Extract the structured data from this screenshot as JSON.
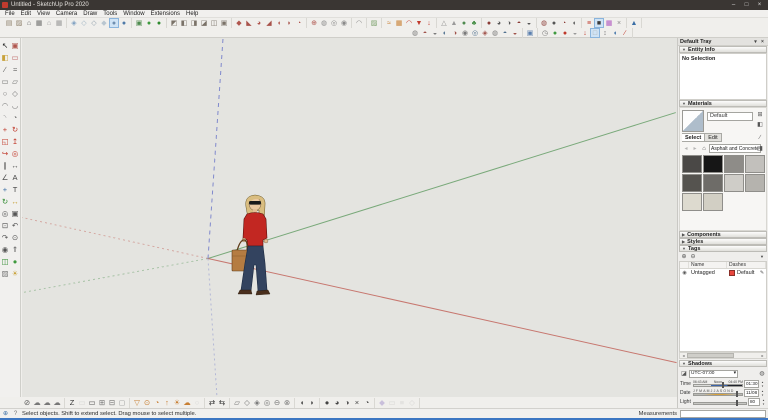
{
  "window": {
    "title": "Untitled - SketchUp Pro 2020",
    "controls": {
      "minimize": "–",
      "maximize": "□",
      "close": "×"
    }
  },
  "menu": {
    "items": [
      "File",
      "Edit",
      "View",
      "Camera",
      "Draw",
      "Tools",
      "Window",
      "Extensions",
      "Help"
    ]
  },
  "toolbar_top": {
    "g1": [
      {
        "n": "new-icon",
        "g": "▤",
        "c": "#8d7f6a"
      },
      {
        "n": "open-icon",
        "g": "▨",
        "c": "#8d7f6a"
      },
      {
        "n": "save-icon",
        "g": "⌂",
        "c": "#5f5f5f"
      },
      {
        "n": "print-icon",
        "g": "▦",
        "c": "#6f6f6f"
      },
      {
        "n": "new-template-icon",
        "g": "⌂",
        "c": "#9a9a9a"
      },
      {
        "n": "print-preview-icon",
        "g": "▦",
        "c": "#9a9a9a"
      }
    ],
    "g2": [
      {
        "n": "xray-icon",
        "g": "◈",
        "c": "#7d9fc0"
      },
      {
        "n": "back-edges-icon",
        "g": "◇",
        "c": "#9ab0c0"
      },
      {
        "n": "wireframe-icon",
        "g": "◇",
        "c": "#8a9aa8"
      },
      {
        "n": "hidden-line-icon",
        "g": "◆",
        "c": "#b9c6d0"
      },
      {
        "n": "shaded-icon",
        "g": "●",
        "c": "#6f8fb0",
        "active": true
      },
      {
        "n": "shaded-textures-icon",
        "g": "●",
        "c": "#4f7aa8"
      }
    ],
    "g3": [
      {
        "n": "in-model-icon",
        "g": "▣",
        "c": "#4d8a4d"
      },
      {
        "n": "components-sphere-icon",
        "g": "●",
        "c": "#3f9a3f"
      },
      {
        "n": "warehouse-sphere-icon",
        "g": "●",
        "c": "#2f8a2f"
      }
    ],
    "g4": [
      {
        "n": "iso-view-icon",
        "g": "◩",
        "c": "#7a7268"
      },
      {
        "n": "top-view-icon",
        "g": "◧",
        "c": "#7a7268"
      },
      {
        "n": "front-view-icon",
        "g": "◨",
        "c": "#7a7268"
      },
      {
        "n": "right-view-icon",
        "g": "◪",
        "c": "#7a7268"
      },
      {
        "n": "back-view-icon",
        "g": "◫",
        "c": "#7a7268"
      },
      {
        "n": "left-view-icon",
        "g": "▣",
        "c": "#7a7268"
      }
    ],
    "g5": [
      {
        "n": "outer-shell-icon",
        "g": "◆",
        "c": "#b0564e"
      },
      {
        "n": "intersect-icon",
        "g": "◣",
        "c": "#a8524a"
      },
      {
        "n": "union-icon",
        "g": "◕",
        "c": "#b0564e"
      },
      {
        "n": "subtract-icon",
        "g": "◢",
        "c": "#a8524a"
      },
      {
        "n": "trim-icon",
        "g": "◖",
        "c": "#b0564e"
      },
      {
        "n": "split-icon",
        "g": "◗",
        "c": "#a8524a"
      },
      {
        "n": "soften-icon",
        "g": "◔",
        "c": "#b0564e"
      }
    ],
    "g6": [
      {
        "n": "section-plane-icon",
        "g": "⊕",
        "c": "#b0564e"
      },
      {
        "n": "display-section-planes-icon",
        "g": "◍",
        "c": "#8a8a8a"
      },
      {
        "n": "display-section-cuts-icon",
        "g": "◎",
        "c": "#8a8a8a"
      },
      {
        "n": "section-fill-icon",
        "g": "◉",
        "c": "#8a8a8a"
      }
    ],
    "g7": [
      {
        "n": "bezier-icon",
        "g": "◠",
        "c": "#888888"
      }
    ],
    "g8": [
      {
        "n": "photo-match-icon",
        "g": "▨",
        "c": "#7aa06a"
      }
    ],
    "g9": [
      {
        "n": "from-contours-icon",
        "g": "≈",
        "c": "#c87f33"
      },
      {
        "n": "from-scratch-icon",
        "g": "▦",
        "c": "#c87f33"
      },
      {
        "n": "smoove-icon",
        "g": "◠",
        "c": "#c0392b"
      },
      {
        "n": "stamp-icon",
        "g": "▼",
        "c": "#c0392b"
      },
      {
        "n": "drape-icon",
        "g": "↓",
        "c": "#c0392b"
      }
    ],
    "g10": [
      {
        "n": "add-detail-icon",
        "g": "△",
        "c": "#8a8a8a"
      },
      {
        "n": "flip-edge-icon",
        "g": "▲",
        "c": "#9a9a9a"
      },
      {
        "n": "earth-icon",
        "g": "●",
        "c": "#4f8a4f"
      },
      {
        "n": "foliage-icon",
        "g": "♣",
        "c": "#3f8a3f"
      }
    ],
    "g11": [
      {
        "n": "interact-icon",
        "g": "●",
        "c": "#8a3b35"
      },
      {
        "n": "component-options-icon",
        "g": "◕",
        "c": "#555555"
      },
      {
        "n": "component-attributes-icon",
        "g": "◑",
        "c": "#555555"
      },
      {
        "n": "fog-icon",
        "g": "◓",
        "c": "#8a3b35"
      },
      {
        "n": "soften-edges-icon",
        "g": "◒",
        "c": "#555555"
      }
    ],
    "g12": [
      {
        "n": "warehouse-icon",
        "g": "◍",
        "c": "#8a3b35"
      },
      {
        "n": "share-model-icon",
        "g": "●",
        "c": "#555555"
      },
      {
        "n": "share-component-icon",
        "g": "◔",
        "c": "#8a3b35"
      },
      {
        "n": "extension-store-icon",
        "g": "◖",
        "c": "#555555"
      }
    ],
    "g13": [
      {
        "n": "tags-toolbar-icon",
        "g": "≡",
        "c": "#c0392b"
      },
      {
        "n": "screen-icon",
        "g": "■",
        "c": "#3a3a3a",
        "active": true
      },
      {
        "n": "color-gradient-icon",
        "g": "▦",
        "c": "#b05ac0"
      },
      {
        "n": "cut-icon",
        "g": "×",
        "c": "#888888"
      }
    ],
    "g14": [
      {
        "n": "layout-icon",
        "g": "▲",
        "c": "#3a6ea5"
      }
    ]
  },
  "toolbar_second": {
    "s1": [
      {
        "n": "create-camera-icon",
        "g": "◍",
        "c": "#7a7a7a"
      },
      {
        "n": "look-through-camera-icon",
        "g": "◓",
        "c": "#a0524a"
      },
      {
        "n": "lock-camera-icon",
        "g": "◒",
        "c": "#7a7a7a"
      },
      {
        "n": "camera-dolly-icon",
        "g": "◐",
        "c": "#51718f"
      },
      {
        "n": "camera-pan-icon",
        "g": "◑",
        "c": "#a0524a"
      },
      {
        "n": "camera-orbit-icon",
        "g": "◉",
        "c": "#7a7a7a"
      },
      {
        "n": "camera-zoom-icon",
        "g": "◎",
        "c": "#51718f"
      },
      {
        "n": "camera-roll-icon",
        "g": "◈",
        "c": "#a0524a"
      },
      {
        "n": "camera-truck-icon",
        "g": "◍",
        "c": "#7a7a7a"
      },
      {
        "n": "camera-pedestal-icon",
        "g": "◓",
        "c": "#51718f"
      },
      {
        "n": "camera-frustum-icon",
        "g": "◒",
        "c": "#a0524a"
      }
    ],
    "s2": [
      {
        "n": "save-scene-icon",
        "g": "▣",
        "c": "#5b7fae"
      }
    ],
    "s3": [
      {
        "n": "time-icon",
        "g": "◷",
        "c": "#777777"
      },
      {
        "n": "add-location-icon",
        "g": "●",
        "c": "#3f9a3f"
      },
      {
        "n": "remove-location-icon",
        "g": "●",
        "c": "#c0392b"
      },
      {
        "n": "show-terrain-icon",
        "g": "◒",
        "c": "#999999"
      },
      {
        "n": "import-terrain-icon",
        "g": "↓",
        "c": "#c0392b"
      },
      {
        "n": "toggle-terrain-icon",
        "g": "□",
        "c": "#aaaaaa",
        "active": true
      },
      {
        "n": "elevation-icon",
        "g": "↕",
        "c": "#777777"
      },
      {
        "n": "speech-icon",
        "g": "◖",
        "c": "#3a6ea5"
      },
      {
        "n": "redline-icon",
        "g": "∕",
        "c": "#c0392b"
      }
    ]
  },
  "left_palette": {
    "tools": [
      {
        "n": "select-icon",
        "g": "↖",
        "c": "#222222"
      },
      {
        "n": "make-component-icon",
        "g": "▣",
        "c": "#b0564e"
      },
      {
        "n": "paint-bucket-icon",
        "g": "◧",
        "c": "#c8a23a"
      },
      {
        "n": "eraser-icon",
        "g": "▭",
        "c": "#c06a6a"
      },
      {
        "n": "line-icon",
        "g": "∕",
        "c": "#555555"
      },
      {
        "n": "freehand-icon",
        "g": "≈",
        "c": "#555555"
      },
      {
        "n": "rectangle-icon",
        "g": "▭",
        "c": "#777777"
      },
      {
        "n": "rotated-rectangle-icon",
        "g": "▱",
        "c": "#777777"
      },
      {
        "n": "circle-icon",
        "g": "○",
        "c": "#777777"
      },
      {
        "n": "polygon-icon",
        "g": "◇",
        "c": "#777777"
      },
      {
        "n": "arc-icon",
        "g": "◠",
        "c": "#777777"
      },
      {
        "n": "two-point-arc-icon",
        "g": "◡",
        "c": "#777777"
      },
      {
        "n": "three-point-arc-icon",
        "g": "◝",
        "c": "#999999"
      },
      {
        "n": "pie-icon",
        "g": "◔",
        "c": "#777777"
      },
      {
        "n": "move-icon",
        "g": "+",
        "c": "#c0392b"
      },
      {
        "n": "rotate-icon",
        "g": "↻",
        "c": "#c0392b"
      },
      {
        "n": "scale-icon",
        "g": "◱",
        "c": "#c0392b"
      },
      {
        "n": "push-pull-icon",
        "g": "↥",
        "c": "#c0392b"
      },
      {
        "n": "follow-me-icon",
        "g": "↪",
        "c": "#c0392b"
      },
      {
        "n": "offset-icon",
        "g": "◎",
        "c": "#c0392b"
      },
      {
        "n": "tape-measure-icon",
        "g": "∥",
        "c": "#555555"
      },
      {
        "n": "dimensions-icon",
        "g": "↔",
        "c": "#555555"
      },
      {
        "n": "protractor-icon",
        "g": "∠",
        "c": "#555555"
      },
      {
        "n": "text-icon",
        "g": "A",
        "c": "#444444"
      },
      {
        "n": "axes-icon",
        "g": "+",
        "c": "#3a6ea5"
      },
      {
        "n": "3d-text-icon",
        "g": "T",
        "c": "#444444"
      },
      {
        "n": "orbit-icon",
        "g": "↻",
        "c": "#2f8a2f"
      },
      {
        "n": "pan-icon",
        "g": "↔",
        "c": "#c8a23a"
      },
      {
        "n": "zoom-icon",
        "g": "◎",
        "c": "#555555"
      },
      {
        "n": "zoom-window-icon",
        "g": "▣",
        "c": "#555555"
      },
      {
        "n": "zoom-extents-icon",
        "g": "⊡",
        "c": "#555555"
      },
      {
        "n": "previous-icon",
        "g": "↶",
        "c": "#555555"
      },
      {
        "n": "next-icon",
        "g": "↷",
        "c": "#555555"
      },
      {
        "n": "position-camera-icon",
        "g": "⊙",
        "c": "#555555"
      },
      {
        "n": "look-around-icon",
        "g": "◉",
        "c": "#555555"
      },
      {
        "n": "walk-icon",
        "g": "⇑",
        "c": "#555555"
      },
      {
        "n": "section-plane-icon",
        "g": "◫",
        "c": "#2f8a2f"
      },
      {
        "n": "add-location-icon",
        "g": "●",
        "c": "#3f9a3f"
      },
      {
        "n": "match-photo-icon",
        "g": "▨",
        "c": "#777777"
      },
      {
        "n": "shadows-icon",
        "g": "☀",
        "c": "#c8a23a"
      }
    ]
  },
  "viewport": {
    "background": "#e4e4e0",
    "axes": {
      "red": "#c7776f",
      "green": "#79a97a",
      "blue": "#8089cc"
    },
    "figure": {
      "hair": "#d9bd80",
      "skin": "#ecc9a0",
      "sweater": "#c22722",
      "jeans": "#33435f",
      "bag": "#b57c42"
    }
  },
  "tray": {
    "title": "Default Tray",
    "pin_icon": "▾",
    "close_icon": "×",
    "entity_info": {
      "arrow": "▼",
      "title": "Entity Info",
      "message": "No Selection"
    },
    "materials": {
      "arrow": "▼",
      "title": "Materials",
      "name_value": "Default",
      "create_icon": "⊞",
      "default_paint_icon": "◧",
      "sample_icon": "∕",
      "tabs": [
        {
          "n": "tab-select",
          "label": "Select",
          "active": true
        },
        {
          "n": "tab-edit",
          "label": "Edit"
        }
      ],
      "back_icon": "◂",
      "forward_icon": "▸",
      "home_icon": "⌂",
      "collection": "Asphalt and Concrete",
      "dropdown_arrow": "▾",
      "collections_icon": "◨",
      "swatches": [
        {
          "n": "swatch-asphalt-dark",
          "bg": "#4a4846"
        },
        {
          "n": "swatch-asphalt-new",
          "bg": "#161616"
        },
        {
          "n": "swatch-concrete-gray",
          "bg": "#8e8c88"
        },
        {
          "n": "swatch-concrete-light",
          "bg": "#c2c0bc"
        },
        {
          "n": "swatch-asphalt-old",
          "bg": "#55534f"
        },
        {
          "n": "swatch-concrete-medium",
          "bg": "#6e6c68"
        },
        {
          "n": "swatch-concrete-pavers",
          "bg": "#cfcdc8"
        },
        {
          "n": "swatch-concrete-aggregate",
          "bg": "#b5b3ae"
        },
        {
          "n": "swatch-concrete-smooth",
          "bg": "#dddacf"
        },
        {
          "n": "swatch-concrete-stamped",
          "bg": "#d2cfc4"
        }
      ]
    },
    "components": {
      "arrow": "▶",
      "title": "Components"
    },
    "styles": {
      "arrow": "▶",
      "title": "Styles"
    },
    "tags": {
      "arrow": "▼",
      "title": "Tags",
      "add_icon": "⊕",
      "remove_icon": "⊖",
      "filter_icon": "▼",
      "col_name": "Name",
      "col_dashes": "Dashes",
      "eye_icon": "◉",
      "pencil_icon": "✎",
      "row": {
        "name": "Untagged",
        "dashes": "Default",
        "swatch": "#e8473e"
      }
    },
    "shadows": {
      "arrow": "▼",
      "title": "Shadows",
      "toggle_icon": "◪",
      "bulb_icon": "◍",
      "timezone": "UTC-07:00",
      "dropdown_arrow": "▾",
      "time_label": "Time",
      "time_start": "06:43 AM",
      "time_mid": "Noon",
      "time_end": "04:40 PM",
      "time_value": "01:30 PM",
      "date_label": "Date",
      "date_months": "JFMAMJJASOND",
      "date_value": "11/08",
      "light_label": "Light",
      "light_value": "80",
      "stepper_up": "▴",
      "stepper_down": "▾"
    }
  },
  "toolbar_bottom": {
    "b1": [
      {
        "n": "no-entry-icon",
        "g": "⊘",
        "c": "#555555"
      },
      {
        "n": "cloud-1-icon",
        "g": "☁",
        "c": "#777777"
      },
      {
        "n": "cloud-2-icon",
        "g": "☁",
        "c": "#777777"
      },
      {
        "n": "cloud-3-icon",
        "g": "☁",
        "c": "#777777"
      }
    ],
    "b2": [
      {
        "n": "z-tool-icon",
        "g": "Z",
        "c": "#333333"
      },
      {
        "n": "disabled-tool-icon",
        "g": "▭",
        "c": "#bbbbbb",
        "dim": true
      },
      {
        "n": "monitor-icon",
        "g": "▭",
        "c": "#555555"
      },
      {
        "n": "window-grid-icon",
        "g": "⊞",
        "c": "#777777"
      },
      {
        "n": "window-split-icon",
        "g": "⊟",
        "c": "#777777"
      },
      {
        "n": "lock-icon",
        "g": "◻",
        "c": "#999999"
      }
    ],
    "b3": [
      {
        "n": "funnel-icon",
        "g": "▽",
        "c": "#c87f33"
      },
      {
        "n": "person-target-icon",
        "g": "⊙",
        "c": "#c87f33"
      },
      {
        "n": "protractor-orange-icon",
        "g": "◔",
        "c": "#c87f33"
      },
      {
        "n": "up-arrow-icon",
        "g": "↑",
        "c": "#c87f33"
      },
      {
        "n": "sun-icon",
        "g": "☀",
        "c": "#c87f33"
      },
      {
        "n": "cloud-orange-icon",
        "g": "☁",
        "c": "#c87f33"
      },
      {
        "n": "circle-dim-icon",
        "g": "○",
        "c": "#bbbbbb",
        "dim": true
      }
    ],
    "b4": [
      {
        "n": "swap-arrows-icon",
        "g": "⇄",
        "c": "#333333"
      },
      {
        "n": "swap-arrows-2-icon",
        "g": "⇆",
        "c": "#333333"
      }
    ],
    "b5": [
      {
        "n": "parallelogram-icon",
        "g": "▱",
        "c": "#777777"
      },
      {
        "n": "diamond-icon",
        "g": "◇",
        "c": "#777777"
      },
      {
        "n": "diamond-fill-icon",
        "g": "◈",
        "c": "#777777"
      },
      {
        "n": "ring-icon",
        "g": "◎",
        "c": "#777777"
      },
      {
        "n": "circle-minus-icon",
        "g": "⊖",
        "c": "#777777"
      },
      {
        "n": "circle-x-icon",
        "g": "⊗",
        "c": "#777777"
      }
    ],
    "b6": [
      {
        "n": "half-left-icon",
        "g": "◖",
        "c": "#444444"
      },
      {
        "n": "half-right-icon",
        "g": "◗",
        "c": "#444444"
      }
    ],
    "b7": [
      {
        "n": "dark-sphere-icon",
        "g": "●",
        "c": "#444444"
      },
      {
        "n": "dark-pie-icon",
        "g": "◕",
        "c": "#444444"
      },
      {
        "n": "dark-half-icon",
        "g": "◑",
        "c": "#444444"
      },
      {
        "n": "cross-tool-icon",
        "g": "×",
        "c": "#444444"
      },
      {
        "n": "dark-quarter-icon",
        "g": "◔",
        "c": "#444444"
      }
    ],
    "b8": [
      {
        "n": "purple-diamond-icon",
        "g": "◆",
        "c": "#9a86c8",
        "dim": true
      },
      {
        "n": "dim-rect-icon",
        "g": "▭",
        "c": "#bbbbbb",
        "dim": true
      },
      {
        "n": "dim-lines-icon",
        "g": "≡",
        "c": "#bbbbbb",
        "dim": true
      },
      {
        "n": "dim-diamond-icon",
        "g": "◇",
        "c": "#bbbbbb",
        "dim": true
      }
    ]
  },
  "status": {
    "geo_icon": "⊕",
    "help_icon": "?",
    "hint": "Select objects. Shift to extend select. Drag mouse to select multiple.",
    "measurements_label": "Measurements",
    "measurements_value": ""
  }
}
